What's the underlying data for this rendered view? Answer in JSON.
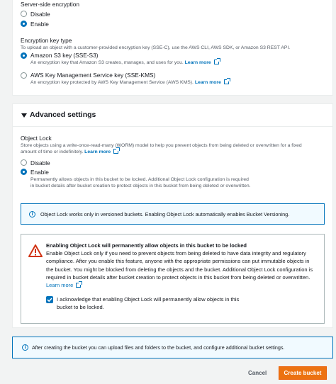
{
  "encryption": {
    "section_label": "Server-side encryption",
    "options": [
      "Disable",
      "Enable"
    ],
    "selected": "Enable",
    "key_type_label": "Encryption key type",
    "key_type_desc": "To upload an object with a customer-provided encryption key (SSE-C), use the AWS CLI, AWS SDK, or Amazon S3 REST API.",
    "sse_s3": {
      "label": "Amazon S3 key (SSE-S3)",
      "desc": "An encryption key that Amazon S3 creates, manages, and uses for you.",
      "learn_more": "Learn more"
    },
    "sse_kms": {
      "label": "AWS Key Management Service key (SSE-KMS)",
      "desc": "An encryption key protected by AWS Key Management Service (AWS KMS).",
      "learn_more": "Learn more"
    }
  },
  "advanced": {
    "title": "Advanced settings",
    "object_lock": {
      "label": "Object Lock",
      "desc": "Store objects using a write-once-read-many (WORM) model to help you prevent objects from being deleted or overwritten for a fixed amount of time or indefinitely.",
      "learn_more": "Learn more",
      "options": {
        "disable": "Disable",
        "enable": "Enable"
      },
      "enable_desc": "Permanently allows objects in this bucket to be locked. Additional Object Lock configuration is required in bucket details after bucket creation to protect objects in this bucket from being deleted or overwritten."
    },
    "versioning_info": "Object Lock works only in versioned buckets. Enabling Object Lock automatically enables Bucket Versioning.",
    "warning": {
      "title": "Enabling Object Lock will permanently allow objects in this bucket to be locked",
      "body": "Enable Object Lock only if you need to prevent objects from being deleted to have data integrity and regulatory compliance. After you enable this feature, anyone with the appropriate permissions can put immutable objects in the bucket. You might be blocked from deleting the objects and the bucket. Additional Object Lock configuration is required in bucket details after bucket creation to protect objects in this bucket from being deleted or overwritten.",
      "learn_more": "Learn more",
      "ack_label": "I acknowledge that enabling Object Lock will permanently allow objects in this bucket to be locked.",
      "ack_checked": true
    }
  },
  "footer_info": "After creating the bucket you can upload files and folders to the bucket, and configure additional bucket settings.",
  "actions": {
    "cancel": "Cancel",
    "create": "Create bucket"
  }
}
